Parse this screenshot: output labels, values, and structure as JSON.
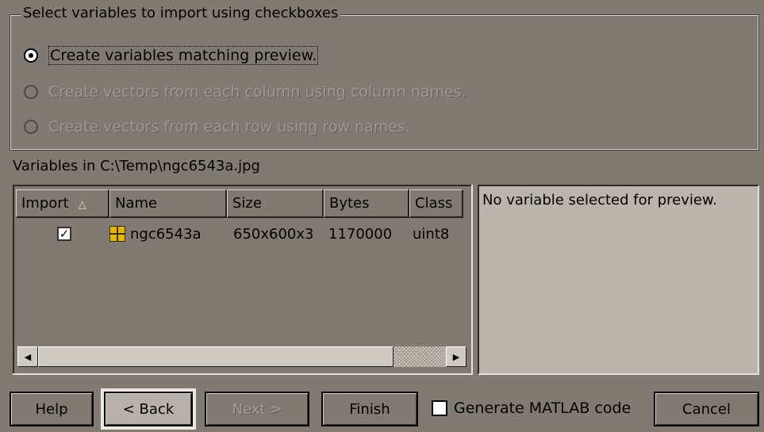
{
  "group": {
    "legend": "Select variables to import using checkboxes",
    "options": [
      {
        "label": "Create variables matching preview.",
        "selected": true,
        "enabled": true
      },
      {
        "label": "Create vectors from each column using column names.",
        "selected": false,
        "enabled": false
      },
      {
        "label": "Create vectors from each row using row names.",
        "selected": false,
        "enabled": false
      }
    ]
  },
  "variables_label": "Variables in C:\\Temp\\ngc6543a.jpg",
  "table": {
    "columns": [
      "Import",
      "Name",
      "Size",
      "Bytes",
      "Class"
    ],
    "sort_indicator": "△",
    "rows": [
      {
        "import_checked": true,
        "check_glyph": "✓",
        "name": "ngc6543a",
        "size": "650x600x3",
        "bytes": "1170000",
        "class": "uint8"
      }
    ]
  },
  "scrollbar": {
    "left_arrow": "◀",
    "right_arrow": "▶"
  },
  "preview": {
    "text": "No variable selected for preview."
  },
  "buttons": {
    "help": "Help",
    "back": "< Back",
    "next": "Next >",
    "finish": "Finish",
    "cancel": "Cancel"
  },
  "generate_code": {
    "label": "Generate MATLAB code",
    "checked": false
  },
  "colors": {
    "background": "#807a72",
    "preview_bg": "#bab4ac",
    "icon": "#e4b800"
  }
}
